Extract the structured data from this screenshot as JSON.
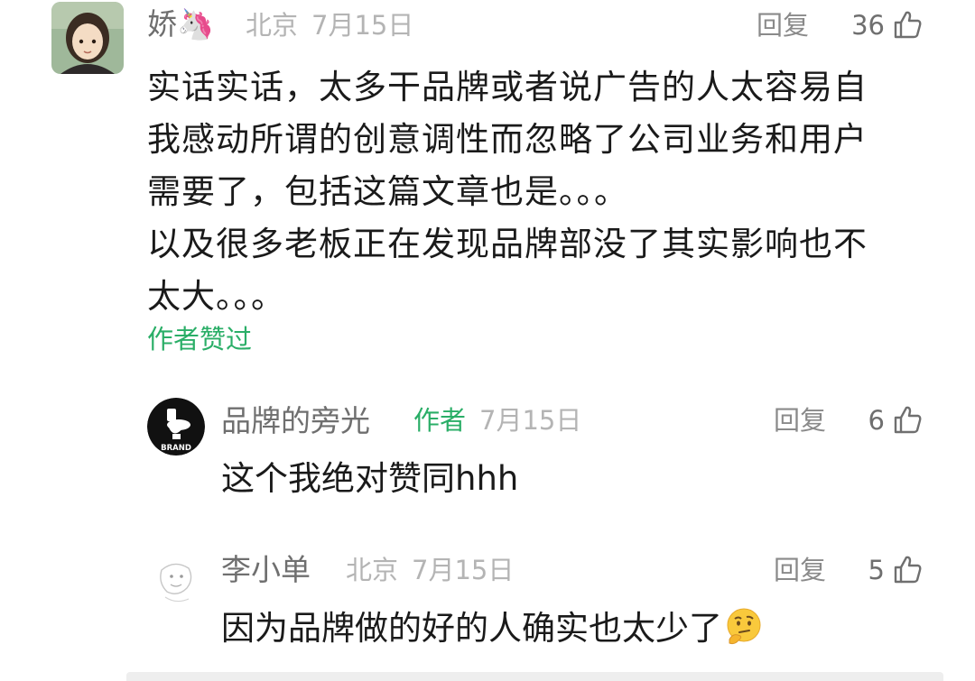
{
  "comment": {
    "username": "娇🦄",
    "location": "北京",
    "date": "7月15日",
    "reply_label": "回复",
    "likes": "36",
    "body": "实话实话，太多干品牌或者说广告的人太容易自\n我感动所谓的创意调性而忽略了公司业务和用户\n需要了，包括这篇文章也是。。。\n以及很多老板正在发现品牌部没了其实影响也不\n太大。。。",
    "liked_by_author": "作者赞过"
  },
  "replies": [
    {
      "username": "品牌的旁光",
      "author_tag": "作者",
      "date": "7月15日",
      "reply_label": "回复",
      "likes": "6",
      "body": "这个我绝对赞同hhh",
      "avatar_text": "BRAND"
    },
    {
      "username": "李小单",
      "location": "北京",
      "date": "7月15日",
      "reply_label": "回复",
      "likes": "5",
      "body": "因为品牌做的好的人确实也太少了"
    }
  ],
  "icons": {
    "like": "thumbs-up-icon",
    "emoji": "thinking-face-emoji-icon"
  },
  "colors": {
    "author_green": "#2aae67",
    "meta_gray": "#b4b4b4",
    "name_gray": "#6f6f6f"
  }
}
